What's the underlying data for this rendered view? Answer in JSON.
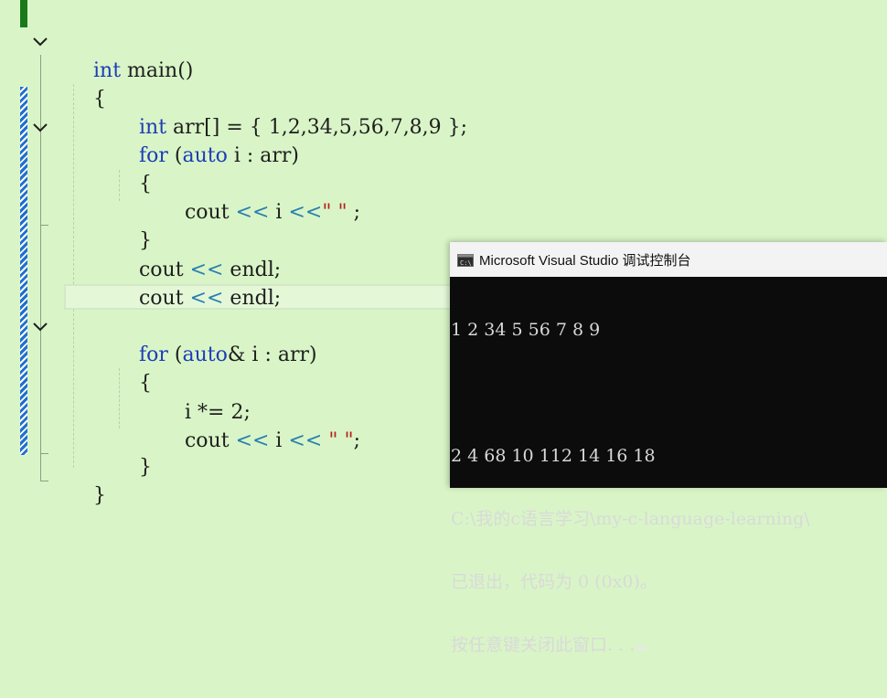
{
  "editor": {
    "code_lines": [
      "int main()",
      "{",
      "int arr[] = { 1,2,34,5,56,7,8,9 };",
      "for (auto i : arr)",
      "{",
      "cout << i <<\" \" ;",
      "}",
      "cout << endl;",
      "cout << endl;",
      "",
      "for (auto& i : arr)",
      "{",
      "i *= 2;",
      "cout << i << \" \";",
      "}",
      "}"
    ],
    "tokens": {
      "int": "int",
      "main": " main()",
      "open_brace": "{",
      "close_brace": "}",
      "arr_decl": " arr[] = { 1,2,34,5,56,7,8,9 };",
      "for": "for",
      "paren_open": " (",
      "auto": "auto",
      "auto_ref": "auto",
      "amp": "&",
      "i_var": " i ",
      "colon_arr": ": arr)",
      "cout": "cout ",
      "shift": "<<",
      "i_mid": " i ",
      "space_str": "\" \"",
      "semicolon_sp": " ;",
      "semicolon": ";",
      "endl": " endl",
      "i_mult": "i *= 2;"
    },
    "colors": {
      "background": "#d9f5c7",
      "keyword": "#1d3cb8",
      "operator": "#2b7fb0",
      "string": "#b71c1c"
    }
  },
  "console": {
    "title": "Microsoft Visual Studio 调试控制台",
    "icon": "console-app-icon",
    "lines": [
      "1 2 34 5 56 7 8 9",
      "",
      "2 4 68 10 112 14 16 18",
      "C:\\我的c语言学习\\my-c-language-learning\\",
      "已退出，代码为 0 (0x0)。",
      "按任意键关闭此窗口. . ."
    ]
  }
}
